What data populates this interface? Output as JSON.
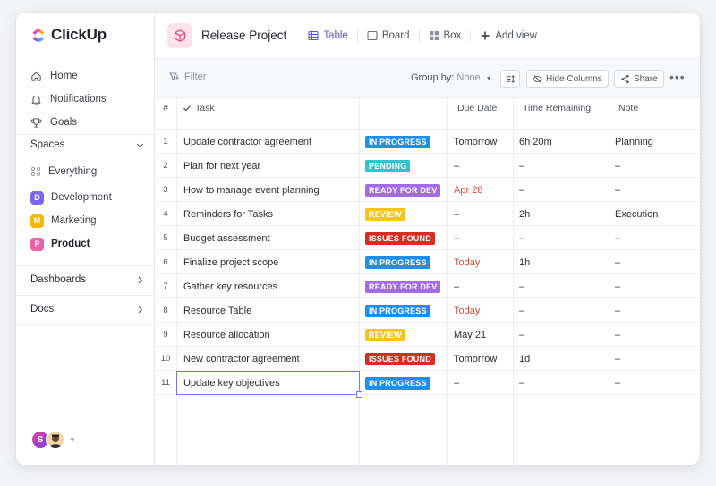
{
  "app": {
    "name": "ClickUp"
  },
  "sidebar": {
    "nav": [
      {
        "label": "Home",
        "icon": "home-icon"
      },
      {
        "label": "Notifications",
        "icon": "bell-icon"
      },
      {
        "label": "Goals",
        "icon": "trophy-icon"
      }
    ],
    "spaces_label": "Spaces",
    "everything_label": "Everything",
    "spaces": [
      {
        "badge": "D",
        "label": "Development",
        "color": "#7b68ee"
      },
      {
        "badge": "M",
        "label": "Marketing",
        "color": "#f5b800"
      },
      {
        "badge": "P",
        "label": "Product",
        "color": "#ef5fa7"
      }
    ],
    "dashboards_label": "Dashboards",
    "docs_label": "Docs",
    "avatar_initial": "S"
  },
  "header": {
    "project_title": "Release Project",
    "tabs": [
      {
        "label": "Table",
        "icon": "table-icon",
        "active": true
      },
      {
        "label": "Board",
        "icon": "board-icon"
      },
      {
        "label": "Box",
        "icon": "box-icon"
      }
    ],
    "add_view_label": "Add view"
  },
  "toolbar": {
    "filter_label": "Filter",
    "group_by_label": "Group by:",
    "group_by_value": "None",
    "hide_columns_label": "Hide Columns",
    "share_label": "Share",
    "more_label": "•••"
  },
  "table": {
    "columns": [
      "#",
      "Task",
      "",
      "Due Date",
      "Time Remaining",
      "Note"
    ],
    "status_colors": {
      "IN PROGRESS": "#1f8ee8",
      "PENDING": "#33c3cf",
      "READY FOR DEV": "#a26bea",
      "REVIEW": "#f5c518",
      "ISSUES FOUND": "#d62c22"
    },
    "rows": [
      {
        "num": "1",
        "task": "Update contractor agreement",
        "status": "IN PROGRESS",
        "due": "Tomorrow",
        "due_red": false,
        "time": "6h 20m",
        "note": "Planning"
      },
      {
        "num": "2",
        "task": "Plan for next year",
        "status": "PENDING",
        "due": "–",
        "due_red": false,
        "time": "–",
        "note": "–"
      },
      {
        "num": "3",
        "task": "How to manage event planning",
        "status": "READY FOR DEV",
        "due": "Apr 28",
        "due_red": true,
        "time": "–",
        "note": "–"
      },
      {
        "num": "4",
        "task": "Reminders for Tasks",
        "status": "REVIEW",
        "due": "–",
        "due_red": false,
        "time": "2h",
        "note": "Execution"
      },
      {
        "num": "5",
        "task": "Budget assessment",
        "status": "ISSUES FOUND",
        "due": "–",
        "due_red": false,
        "time": "–",
        "note": "–"
      },
      {
        "num": "6",
        "task": "Finalize project scope",
        "status": "IN PROGRESS",
        "due": "Today",
        "due_red": true,
        "time": "1h",
        "note": "–"
      },
      {
        "num": "7",
        "task": "Gather key resources",
        "status": "READY FOR DEV",
        "due": "–",
        "due_red": false,
        "time": "–",
        "note": "–"
      },
      {
        "num": "8",
        "task": "Resource Table",
        "status": "IN PROGRESS",
        "due": "Today",
        "due_red": true,
        "time": "–",
        "note": "–"
      },
      {
        "num": "9",
        "task": "Resource allocation",
        "status": "REVIEW",
        "due": "May 21",
        "due_red": false,
        "time": "–",
        "note": "–"
      },
      {
        "num": "10",
        "task": "New contractor agreement",
        "status": "ISSUES FOUND",
        "due": "Tomorrow",
        "due_red": false,
        "time": "1d",
        "note": "–"
      },
      {
        "num": "11",
        "task": "Update key objectives",
        "status": "IN PROGRESS",
        "due": "–",
        "due_red": false,
        "time": "–",
        "note": "–"
      }
    ]
  }
}
